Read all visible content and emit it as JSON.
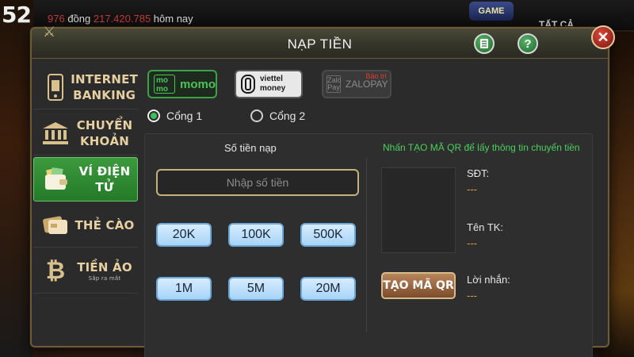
{
  "background": {
    "logo_number": "52",
    "ticker_prefix": "976",
    "ticker_word": "đồng",
    "ticker_amount": "217.420.785",
    "ticker_suffix": "hôm nay",
    "game_badge": "GAME",
    "filter_label": "TẤT CẢ"
  },
  "modal": {
    "title": "NẠP TIỀN",
    "icons": {
      "doc": "document-icon",
      "help": "help-icon",
      "close": "close-icon"
    }
  },
  "sidebar": {
    "items": [
      {
        "label_1": "INTERNET",
        "label_2": "BANKING",
        "icon": "phone-bank-icon",
        "active": false
      },
      {
        "label_1": "CHUYỂN",
        "label_2": "KHOẢN",
        "icon": "bank-icon",
        "active": false
      },
      {
        "label_1": "VÍ ĐIỆN TỬ",
        "label_2": "",
        "icon": "wallet-icon",
        "active": true
      },
      {
        "label_1": "THẺ CÀO",
        "label_2": "",
        "icon": "card-icon",
        "active": false
      },
      {
        "label_1": "TIỀN ẢO",
        "sub": "Sắp ra mắt",
        "icon": "bitcoin-icon",
        "active": false
      }
    ]
  },
  "wallets": {
    "momo": {
      "badge": "mo mo",
      "label": "momo"
    },
    "viettel": {
      "line1": "viettel",
      "line2": "money"
    },
    "zalo": {
      "icon_text": "Zalo Pay",
      "label": "ZALOPAY",
      "status": "Bảo trì"
    }
  },
  "gateways": {
    "gate1": "Cổng 1",
    "gate2": "Cổng 2",
    "selected": "Cổng 1"
  },
  "deposit": {
    "amount_title": "Số tiền nạp",
    "amount_placeholder": "Nhập số tiền",
    "presets": [
      "20K",
      "100K",
      "500K",
      "1M",
      "5M",
      "20M"
    ]
  },
  "qr": {
    "hint": "Nhấn TẠO MÃ QR để lấy thông tin chuyển tiền",
    "button": "TẠO MÃ QR",
    "fields": [
      {
        "label": "SĐT:",
        "value": "---"
      },
      {
        "label": "Tên TK:",
        "value": "---"
      },
      {
        "label": "Lời nhắn:",
        "value": "---"
      }
    ]
  },
  "colors": {
    "accent_green": "#3fbf5a",
    "hint_green": "#4bd05d",
    "gold_border": "#c6b07c",
    "value_orange": "#e3a63a",
    "preset_blue": "#a8d4f6"
  }
}
